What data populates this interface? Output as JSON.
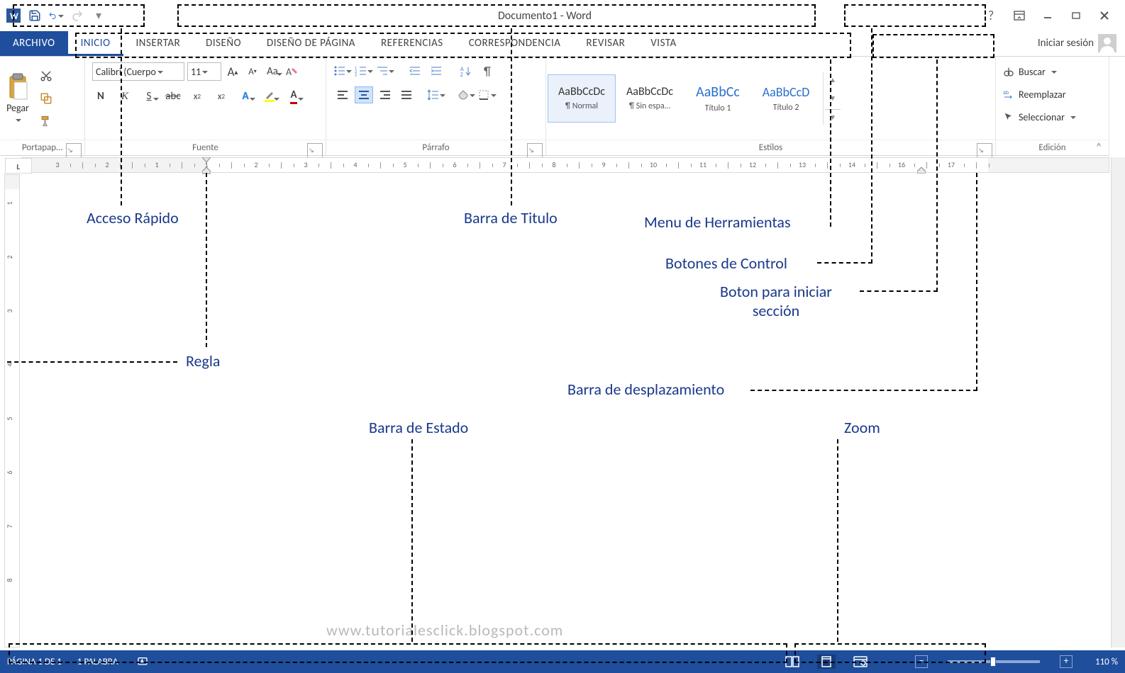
{
  "title": "Documento1 - Word",
  "qat": {
    "save": "save-icon",
    "undo": "undo-icon",
    "redo": "redo-icon"
  },
  "tabs": [
    "ARCHIVO",
    "INICIO",
    "INSERTAR",
    "DISEÑO",
    "DISEÑO DE PÁGINA",
    "REFERENCIAS",
    "CORRESPONDENCIA",
    "REVISAR",
    "VISTA"
  ],
  "signin": "Iniciar sesión",
  "ribbon": {
    "clipboard": {
      "paste": "Pegar",
      "label": "Portapap…"
    },
    "font": {
      "family": "Calibri (Cuerpo",
      "size": "11",
      "increase": "A",
      "decrease": "A",
      "case": "Aa",
      "bold": "N",
      "italic": "K",
      "underline": "S",
      "strike": "abc",
      "sub": "x",
      "sub2": "2",
      "sup": "x",
      "sup2": "2",
      "texteffects": "A",
      "highlight_color": "#ffff00",
      "font_color": "#c00000",
      "label": "Fuente"
    },
    "paragraph": {
      "label": "Párrafo"
    },
    "styles": {
      "label": "Estilos",
      "items": [
        {
          "preview": "AaBbCcDc",
          "name": "¶ Normal",
          "color": "#333",
          "sel": true,
          "size": 16
        },
        {
          "preview": "AaBbCcDc",
          "name": "¶ Sin espa…",
          "color": "#333",
          "size": 16
        },
        {
          "preview": "AaBbCc",
          "name": "Título 1",
          "color": "#2a6fcf",
          "size": 20
        },
        {
          "preview": "AaBbCcD",
          "name": "Título 2",
          "color": "#2a6fcf",
          "size": 18
        }
      ]
    },
    "editing": {
      "find": "Buscar",
      "replace": "Reemplazar",
      "select": "Seleccionar",
      "label": "Edición"
    }
  },
  "ruler": {
    "h_numbers": [
      "3",
      "2",
      "1",
      "1",
      "2",
      "3",
      "4",
      "5",
      "6",
      "7",
      "8",
      "9",
      "10",
      "11",
      "12",
      "13",
      "14",
      "16",
      "17"
    ],
    "h_zero_index": 3,
    "h_spacing": 70,
    "v_numbers": [
      "1",
      "2",
      "3",
      "4",
      "5",
      "6",
      "7",
      "8"
    ],
    "v_spacing": 76
  },
  "status": {
    "page": "PÁGINA 1 DE 1",
    "words": "1 PALABRA",
    "zoom": "110 %"
  },
  "watermark": "www.tutorialesclick.blogspot.com",
  "annotations": {
    "acceso": "Acceso Rápido",
    "titulo": "Barra de Titulo",
    "menu": "Menu de Herramientas",
    "control": "Botones de Control",
    "iniciar": "Boton para iniciar sección",
    "regla": "Regla",
    "desplaz": "Barra de desplazamiento",
    "estado": "Barra de Estado",
    "zoom": "Zoom"
  }
}
